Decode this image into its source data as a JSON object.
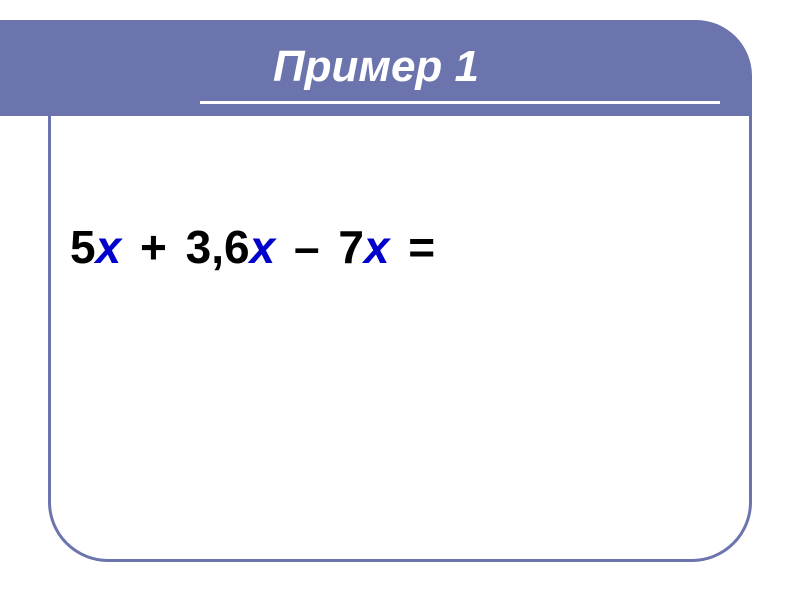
{
  "title": "Пример 1",
  "equation": {
    "t1": {
      "coef": "5",
      "var": "x"
    },
    "op1": "+",
    "t2": {
      "coef": "3,6",
      "var": "x"
    },
    "op2": "–",
    "t3": {
      "coef": "7",
      "var": "x"
    },
    "eq": "="
  }
}
